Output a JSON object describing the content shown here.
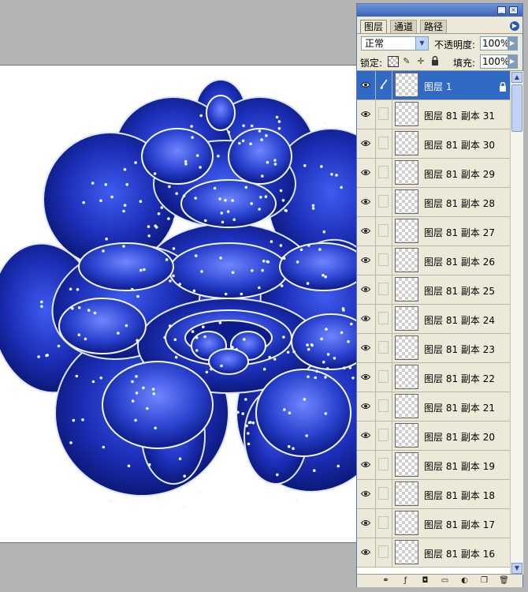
{
  "colors": {
    "canvas_bg": "#b4b4b4",
    "panel_bg": "#ece9d8",
    "selection": "#316ac5",
    "flower_dark": "#0a1a7a",
    "flower_mid": "#2238c8",
    "flower_light": "#cfd8ff"
  },
  "panel": {
    "tabs": [
      "图层",
      "通道",
      "路径"
    ],
    "blend_mode": "正常",
    "opacity_label": "不透明度:",
    "opacity_value": "100%",
    "lock_label": "锁定:",
    "fill_label": "填充:",
    "fill_value": "100%"
  },
  "layers": [
    {
      "name": "图层 1",
      "visible": true,
      "selected": true,
      "locked": true
    },
    {
      "name": "图层 81 副本 31",
      "visible": true
    },
    {
      "name": "图层 81 副本 30",
      "visible": true
    },
    {
      "name": "图层 81 副本 29",
      "visible": true
    },
    {
      "name": "图层 81 副本 28",
      "visible": true
    },
    {
      "name": "图层 81 副本 27",
      "visible": true
    },
    {
      "name": "图层 81 副本 26",
      "visible": true
    },
    {
      "name": "图层 81 副本 25",
      "visible": true
    },
    {
      "name": "图层 81 副本 24",
      "visible": true
    },
    {
      "name": "图层 81 副本 23",
      "visible": true
    },
    {
      "name": "图层 81 副本 22",
      "visible": true
    },
    {
      "name": "图层 81 副本 21",
      "visible": true
    },
    {
      "name": "图层 81 副本 20",
      "visible": true
    },
    {
      "name": "图层 81 副本 19",
      "visible": true
    },
    {
      "name": "图层 81 副本 18",
      "visible": true
    },
    {
      "name": "图层 81 副本 17",
      "visible": true
    },
    {
      "name": "图层 81 副本 16",
      "visible": true
    }
  ],
  "icons": {
    "lock_row": [
      "lock-transparent-icon",
      "brush-icon",
      "move-icon",
      "lock-all-icon"
    ],
    "bottom_bar": [
      "link-icon",
      "layer-style-icon",
      "mask-icon",
      "new-group-icon",
      "adjustment-icon",
      "new-layer-icon",
      "trash-icon"
    ]
  }
}
